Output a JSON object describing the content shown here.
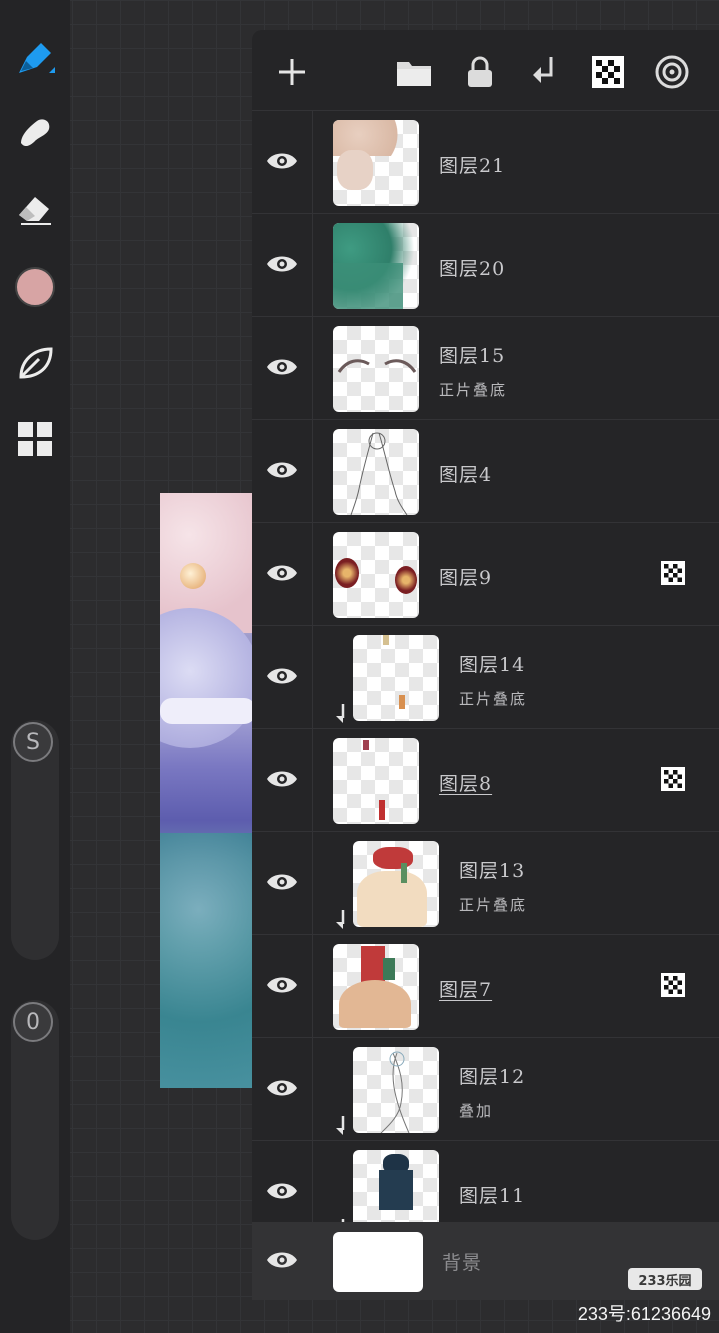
{
  "sliders": {
    "size_label": "S",
    "opacity_label": "0"
  },
  "colors": {
    "accent": "#1e9bf0",
    "current_color": "#d7a4a4"
  },
  "toolbar": {
    "tools": [
      "brush-icon",
      "smudge-icon",
      "eraser-icon",
      "color-swatch",
      "leaf-icon",
      "gallery-icon"
    ]
  },
  "layers_panel": {
    "header_icons": [
      "add-icon",
      "folder-icon",
      "lock-icon",
      "merge-down-icon",
      "alpha-lock-icon",
      "reference-icon"
    ],
    "layers": [
      {
        "name": "图层21",
        "mode": "",
        "clipped": false,
        "alpha_lock": false,
        "underline": false
      },
      {
        "name": "图层20",
        "mode": "",
        "clipped": false,
        "alpha_lock": false,
        "underline": false
      },
      {
        "name": "图层15",
        "mode": "正片叠底",
        "clipped": false,
        "alpha_lock": false,
        "underline": false
      },
      {
        "name": "图层4",
        "mode": "",
        "clipped": false,
        "alpha_lock": false,
        "underline": false
      },
      {
        "name": "图层9",
        "mode": "",
        "clipped": false,
        "alpha_lock": true,
        "underline": false
      },
      {
        "name": "图层14",
        "mode": "正片叠底",
        "clipped": true,
        "alpha_lock": false,
        "underline": false
      },
      {
        "name": "图层8",
        "mode": "",
        "clipped": false,
        "alpha_lock": true,
        "underline": true
      },
      {
        "name": "图层13",
        "mode": "正片叠底",
        "clipped": true,
        "alpha_lock": false,
        "underline": false
      },
      {
        "name": "图层7",
        "mode": "",
        "clipped": false,
        "alpha_lock": true,
        "underline": true
      },
      {
        "name": "图层12",
        "mode": "叠加",
        "clipped": true,
        "alpha_lock": false,
        "underline": false
      },
      {
        "name": "图层11",
        "mode": "",
        "clipped": true,
        "alpha_lock": false,
        "underline": false
      }
    ],
    "background_layer": {
      "name": "背景"
    }
  },
  "watermark": {
    "logo": "233乐园",
    "id": "233号:61236649"
  }
}
